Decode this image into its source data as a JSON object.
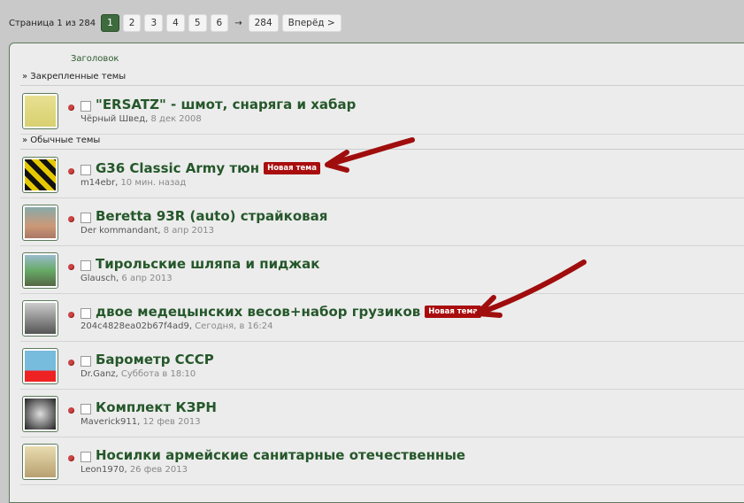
{
  "pager": {
    "label": "Страница 1 из 284",
    "pages": [
      "1",
      "2",
      "3",
      "4",
      "5",
      "6"
    ],
    "current": "1",
    "arrow": "→",
    "last": "284",
    "next": "Вперёд >"
  },
  "column_header": "Заголовок",
  "sections": {
    "pinned": "» Закрепленные темы",
    "normal": "» Обычные темы"
  },
  "badge_new": "Новая тема",
  "pinned": [
    {
      "title": "\"ERSATZ\" - шмот, снаряга и хабар",
      "author": "Чёрный Швед",
      "date": "8 дек 2008",
      "new": false
    }
  ],
  "threads": [
    {
      "title": "G36 Classic Army тюн",
      "author": "m14ebr",
      "date": "10 мин. назад",
      "new": true
    },
    {
      "title": "Beretta 93R (auto) страйковая",
      "author": "Der kommandant",
      "date": "8 апр 2013",
      "new": false
    },
    {
      "title": "Тирольские шляпа и пиджак",
      "author": "Glausch",
      "date": "6 апр 2013",
      "new": false
    },
    {
      "title": "двое медецынских весов+набор грузиков",
      "author": "204c4828ea02b67f4ad9",
      "date": "Сегодня, в 16:24",
      "new": true
    },
    {
      "title": "Барометр СССР",
      "author": "Dr.Ganz",
      "date": "Суббота в 18:10",
      "new": false
    },
    {
      "title": "Комплект КЗРН",
      "author": "Maverick911",
      "date": "12 фев 2013",
      "new": false
    },
    {
      "title": "Носилки армейские санитарные отечественные",
      "author": "Leon1970",
      "date": "26 фев 2013",
      "new": false
    }
  ],
  "colors": {
    "accent": "#3d6b3d",
    "title": "#25572a",
    "badge": "#a90d0d",
    "arrow": "#a00d0d"
  }
}
